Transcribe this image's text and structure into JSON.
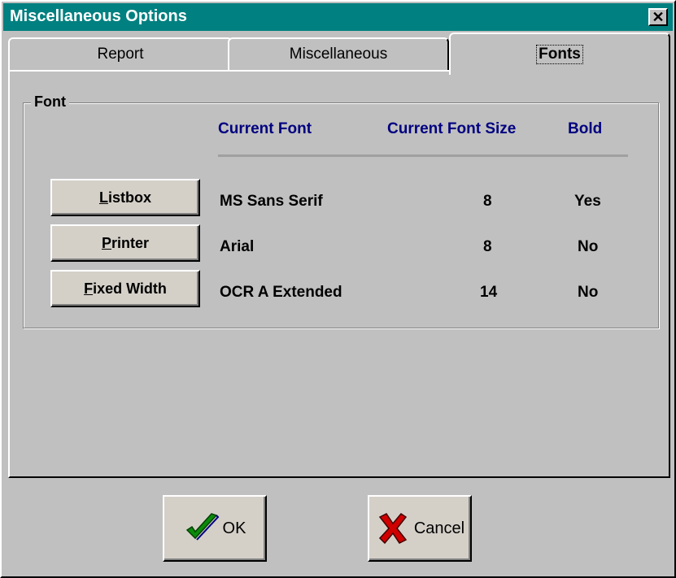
{
  "window": {
    "title": "Miscellaneous Options",
    "close_glyph": "✕"
  },
  "tabs": [
    {
      "label": "Report",
      "active": false
    },
    {
      "label": "Miscellaneous",
      "active": false
    },
    {
      "label": "Fonts",
      "active": true
    }
  ],
  "font_group": {
    "label": "Font",
    "headers": {
      "current_font": "Current Font",
      "current_font_size": "Current Font Size",
      "bold": "Bold"
    },
    "rows": [
      {
        "button_label": "Listbox",
        "mnemonic": "L",
        "font": "MS Sans Serif",
        "size": "8",
        "bold": "Yes"
      },
      {
        "button_label": "Printer",
        "mnemonic": "P",
        "font": "Arial",
        "size": "8",
        "bold": "No"
      },
      {
        "button_label": "Fixed Width",
        "mnemonic": "F",
        "font": "OCR A Extended",
        "size": "14",
        "bold": "No"
      }
    ]
  },
  "footer": {
    "ok_label": "OK",
    "cancel_label": "Cancel",
    "ok_icon": "checkmark-icon",
    "cancel_icon": "red-x-icon"
  },
  "colors": {
    "title_bar": "#008080",
    "header_text": "#000080",
    "face": "#c0c0c0"
  }
}
